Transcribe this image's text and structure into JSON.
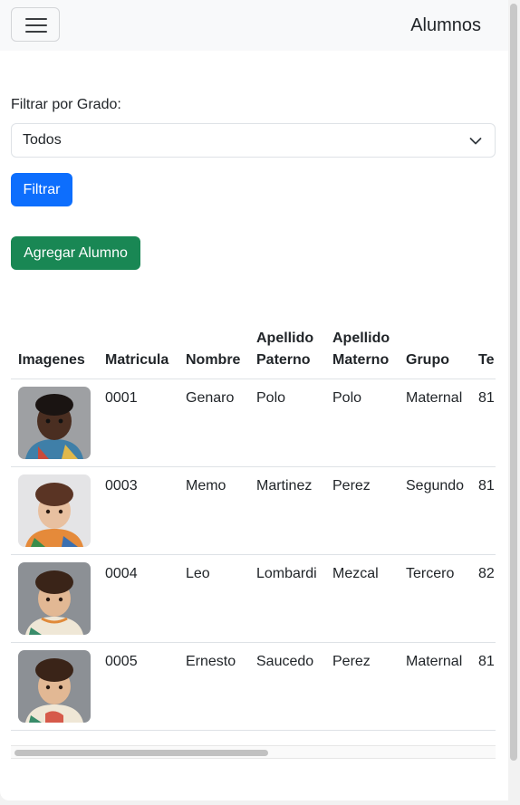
{
  "navbar": {
    "brand": "Alumnos",
    "menu_icon": "hamburger-icon"
  },
  "filter": {
    "label": "Filtrar por Grado:",
    "select_value": "Todos",
    "filter_button": "Filtrar"
  },
  "add_button": "Agregar Alumno",
  "table": {
    "headers": {
      "imagenes": "Imagenes",
      "matricula": "Matricula",
      "nombre": "Nombre",
      "apellido_paterno_1": "Apellido",
      "apellido_paterno_2": "Paterno",
      "apellido_materno_1": "Apellido",
      "apellido_materno_2": "Materno",
      "grupo": "Grupo",
      "telefono_partial": "Te"
    },
    "rows": [
      {
        "matricula": "0001",
        "nombre": "Genaro",
        "apellido_paterno": "Polo",
        "apellido_materno": "Polo",
        "grupo": "Maternal",
        "telefono_partial": "81"
      },
      {
        "matricula": "0003",
        "nombre": "Memo",
        "apellido_paterno": "Martinez",
        "apellido_materno": "Perez",
        "grupo": "Segundo",
        "telefono_partial": "81"
      },
      {
        "matricula": "0004",
        "nombre": "Leo",
        "apellido_paterno": "Lombardi",
        "apellido_materno": "Mezcal",
        "grupo": "Tercero",
        "telefono_partial": "82"
      },
      {
        "matricula": "0005",
        "nombre": "Ernesto",
        "apellido_paterno": "Saucedo",
        "apellido_materno": "Perez",
        "grupo": "Maternal",
        "telefono_partial": "81"
      }
    ]
  }
}
